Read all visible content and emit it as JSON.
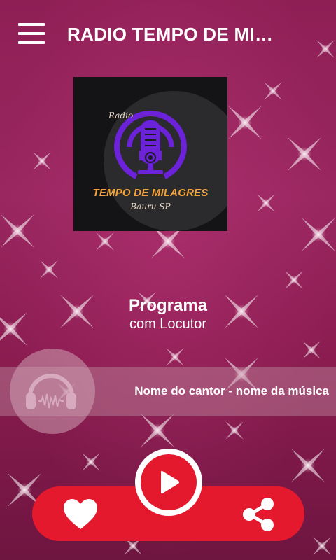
{
  "header": {
    "title": "RADIO TEMPO DE MILAGRES",
    "menu_icon": "hamburger-menu-icon"
  },
  "cover": {
    "small_text": "Radio",
    "main_text": "TEMPO DE MILAGRES",
    "sub_text": "Bauru SP"
  },
  "program": {
    "title": "Programa",
    "host": "com Locutor"
  },
  "now_playing": {
    "song": "Nome do cantor - nome da música",
    "icon": "headphones-icon"
  },
  "controls": {
    "like_icon": "heart-icon",
    "play_icon": "play-icon",
    "share_icon": "share-icon"
  },
  "colors": {
    "background": "#8e1f55",
    "accent": "#e4192e",
    "mic_purple": "#6b22d8",
    "logo_orange": "#f2a43a"
  }
}
